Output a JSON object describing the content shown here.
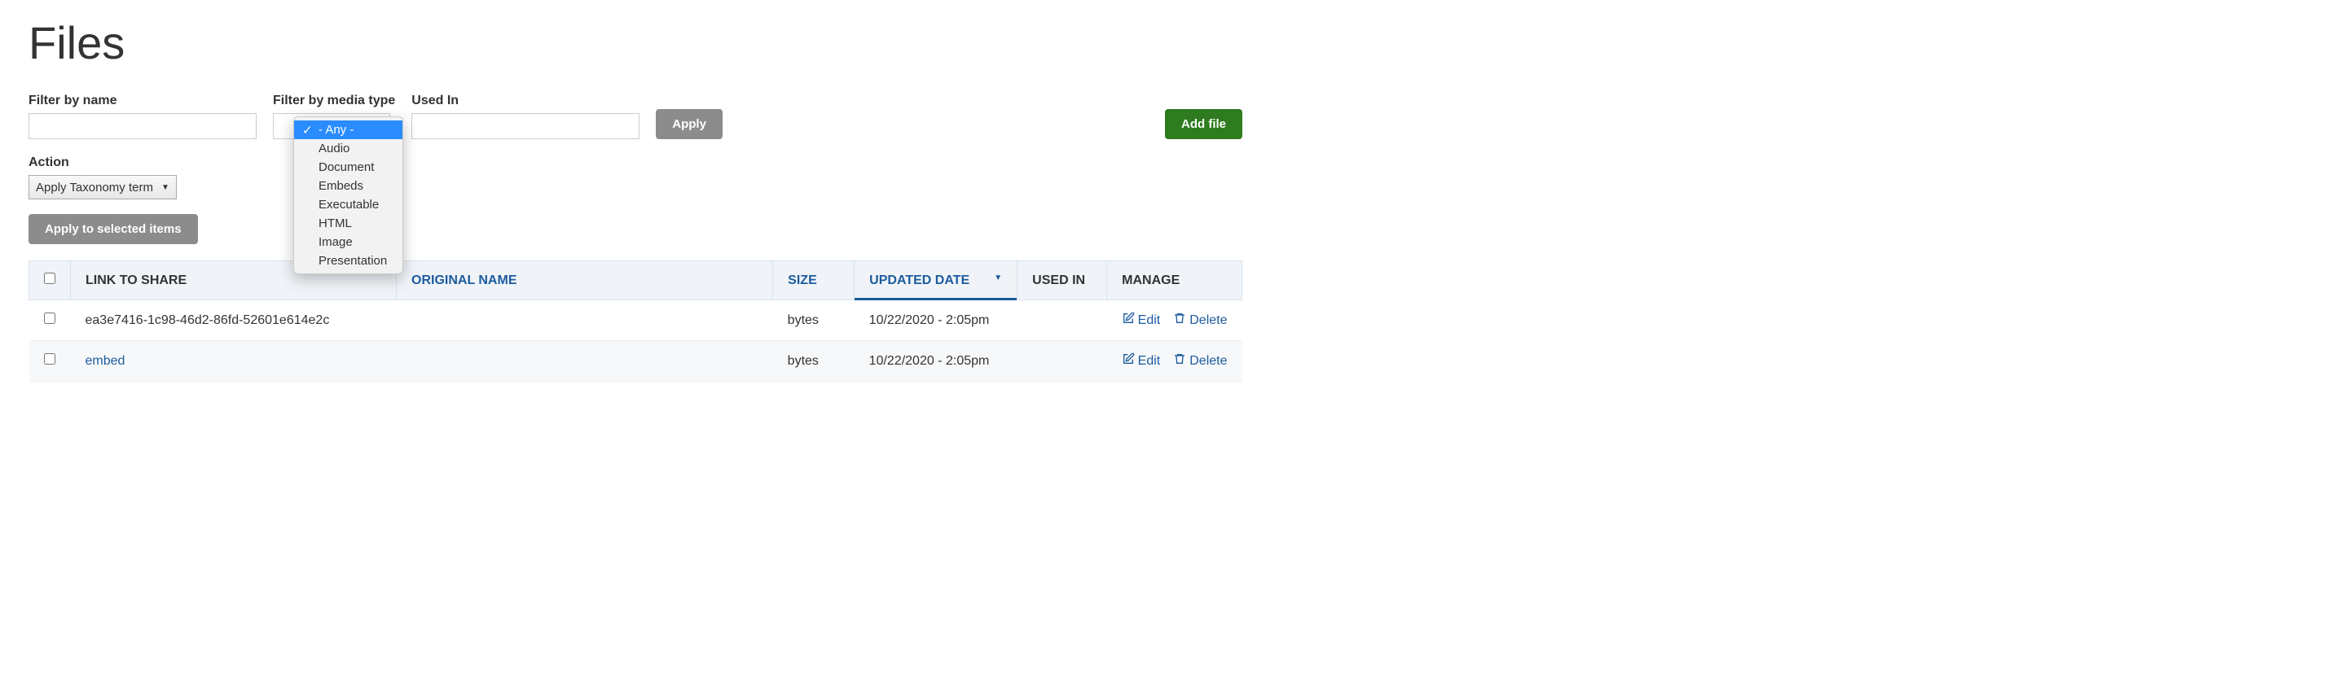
{
  "page_title": "Files",
  "filters": {
    "name_label": "Filter by name",
    "media_label": "Filter by media type",
    "used_label": "Used In",
    "apply_button": "Apply",
    "add_file_button": "Add file"
  },
  "media_dropdown": {
    "options": [
      "- Any -",
      "Audio",
      "Document",
      "Embeds",
      "Executable",
      "HTML",
      "Image",
      "Presentation"
    ],
    "selected": "- Any -"
  },
  "action": {
    "label": "Action",
    "value": "Apply Taxonomy term",
    "apply_selected": "Apply to selected items"
  },
  "table": {
    "headers": {
      "link": "LINK TO SHARE",
      "original": "ORIGINAL NAME",
      "size": "SIZE",
      "updated": "UPDATED DATE",
      "used": "USED IN",
      "manage": "MANAGE"
    },
    "rows": [
      {
        "link": "ea3e7416-1c98-46d2-86fd-52601e614e2c",
        "link_is_link": false,
        "original": "",
        "size": "bytes",
        "updated": "10/22/2020 - 2:05pm",
        "used": "",
        "edit": "Edit",
        "delete": "Delete"
      },
      {
        "link": "embed",
        "link_is_link": true,
        "original": "",
        "size": "bytes",
        "updated": "10/22/2020 - 2:05pm",
        "used": "",
        "edit": "Edit",
        "delete": "Delete"
      }
    ]
  }
}
